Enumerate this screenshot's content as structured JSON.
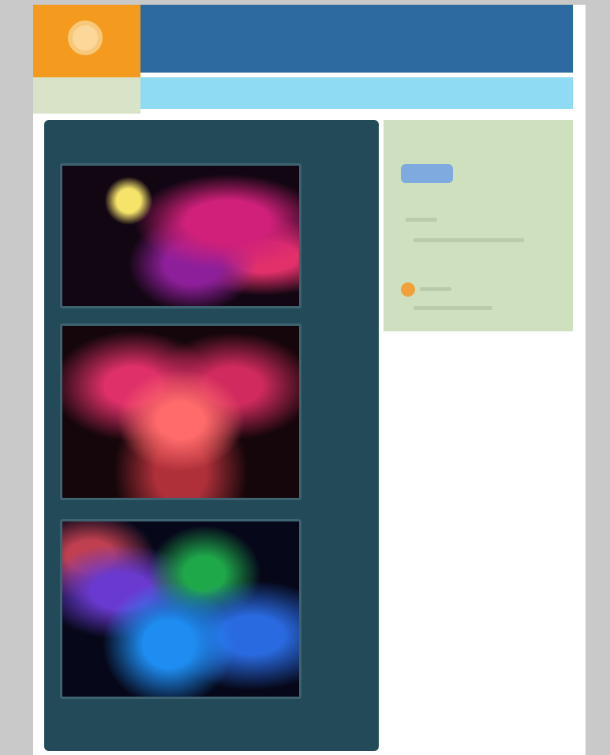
{
  "header": {
    "site_title": "",
    "logo_icon": "circle-logo-icon"
  },
  "main": {
    "heading": "",
    "photos": [
      {
        "name": "concert-photo-1"
      },
      {
        "name": "concert-photo-2"
      },
      {
        "name": "concert-photo-3"
      }
    ],
    "footer_text": ""
  },
  "sidebar": {
    "label": "",
    "button_label": "",
    "icon": "feed-icon"
  },
  "colors": {
    "background": "#c9c9c9",
    "logo_orange": "#f49a1f",
    "header_blue": "#2c6a9f",
    "subnav_light_blue": "#8fdbf3",
    "panel_dark_teal": "#224a58",
    "heading_green": "#6fc53a",
    "sidebar_green": "#cfe0be",
    "button_blue": "#7faadf"
  }
}
